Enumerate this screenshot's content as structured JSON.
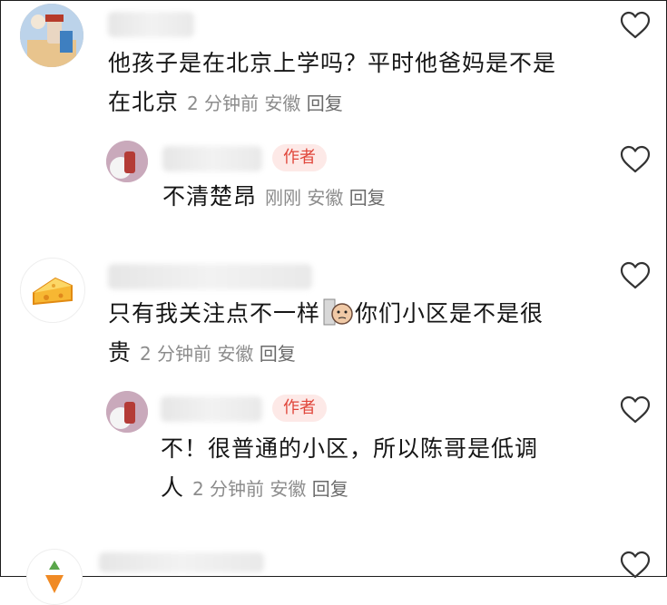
{
  "comments": [
    {
      "text_line1": "他孩子是在北京上学吗？平时他爸妈是不是",
      "text_line2": "在北京",
      "time": "2 分钟前",
      "location": "安徽",
      "reply": "回复"
    },
    {
      "badge": "作者",
      "text_line1": "不清楚昂",
      "time": "刚刚",
      "location": "安徽",
      "reply": "回复"
    },
    {
      "text_line1_a": "只有我关注点不一样",
      "text_line1_b": "你们小区是不是很",
      "text_line2": "贵",
      "time": "2 分钟前",
      "location": "安徽",
      "reply": "回复"
    },
    {
      "badge": "作者",
      "text_line1": "不！很普通的小区，所以陈哥是低调",
      "text_line2": "人",
      "time": "2 分钟前",
      "location": "安徽",
      "reply": "回复"
    }
  ],
  "icons": {
    "like": "heart-outline-icon",
    "sticker": "face-emoji-sticker",
    "cheese_avatar": "cheese-icon"
  },
  "colors": {
    "badge_bg": "#fde9e7",
    "badge_text": "#e0463b",
    "meta_text": "#8c8c8c",
    "body_text": "#161616"
  }
}
